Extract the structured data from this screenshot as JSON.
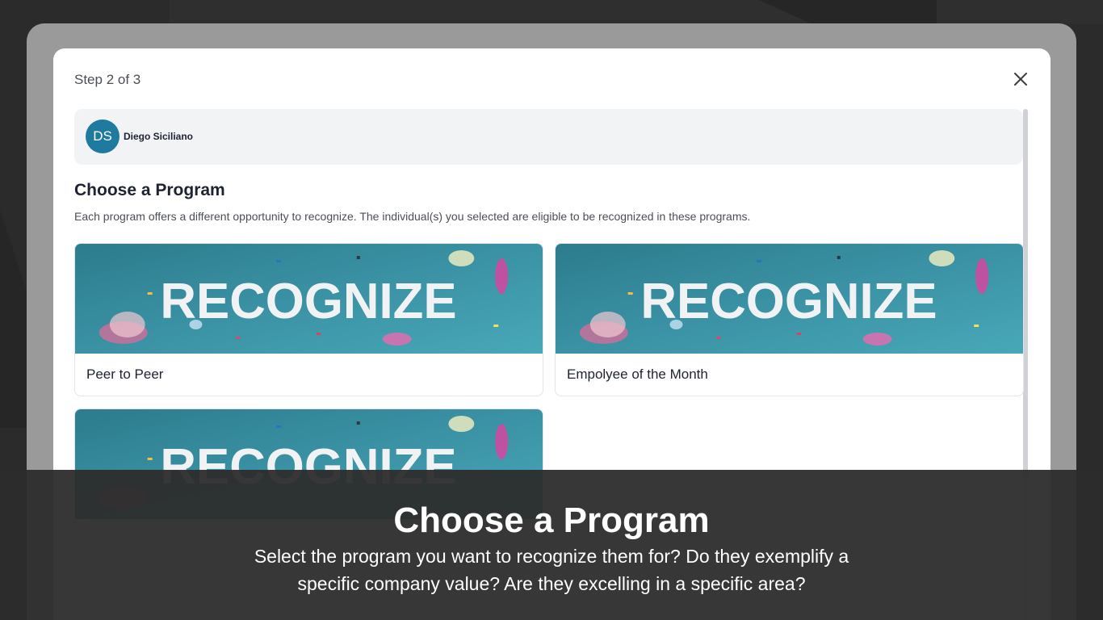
{
  "modal": {
    "step_label": "Step 2 of 3",
    "close_icon": "close-icon"
  },
  "recipient": {
    "initials": "DS",
    "name": "Diego Siciliano",
    "avatar_color": "#1e7a9e"
  },
  "program_section": {
    "title": "Choose a Program",
    "description": "Each program offers a different opportunity to recognize. The individual(s) you selected are eligible to be recognized in these programs."
  },
  "programs": [
    {
      "label": "Peer to Peer",
      "banner_text": "RECOGNIZE"
    },
    {
      "label": "Empolyee of the Month",
      "banner_text": "RECOGNIZE"
    },
    {
      "label": "",
      "banner_text": "RECOGNIZE"
    }
  ],
  "overlay": {
    "title": "Choose a Program",
    "body": "Select the program you want to recognize them for? Do they exemplify a specific company value? Are they excelling in a specific area?"
  }
}
